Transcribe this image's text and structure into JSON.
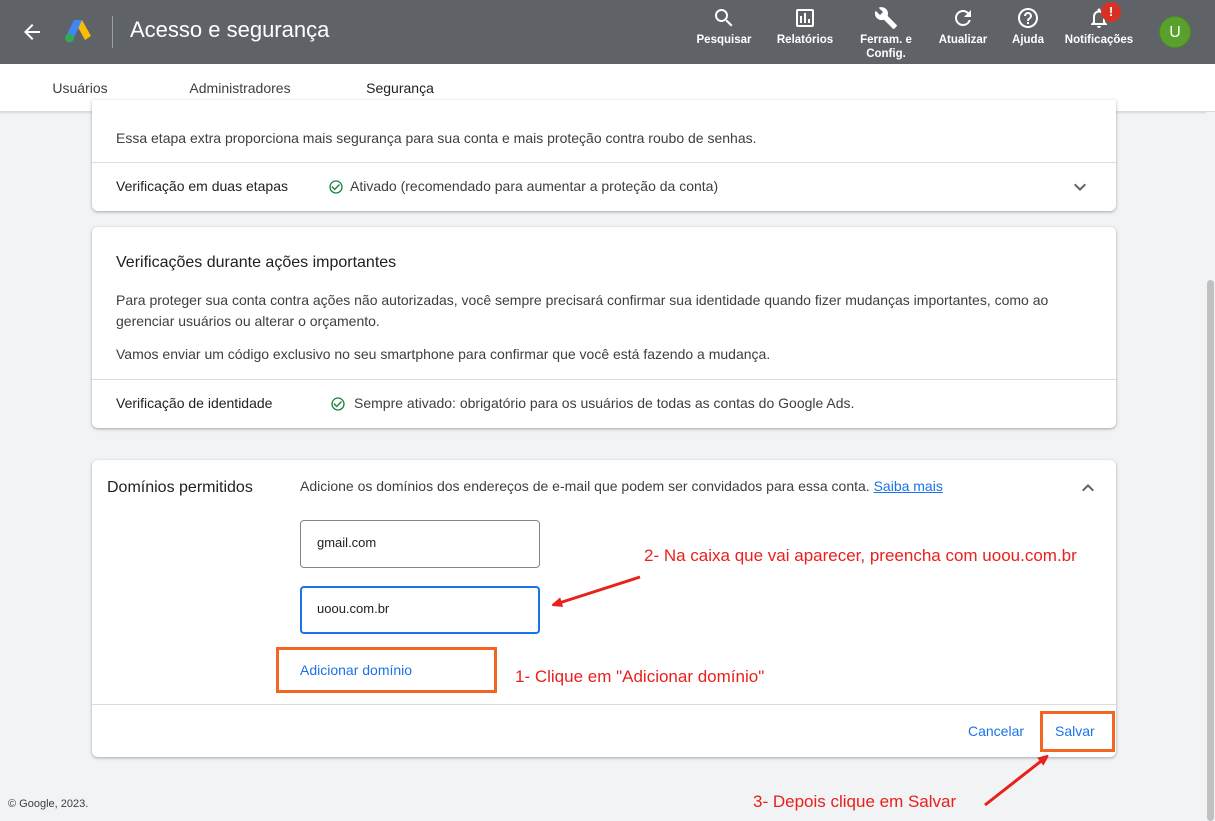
{
  "header": {
    "title": "Acesso e segurança",
    "tools": [
      {
        "label": "Pesquisar",
        "icon": "search-icon"
      },
      {
        "label": "Relatórios",
        "icon": "reports-icon"
      },
      {
        "label": "Ferram. e Config.",
        "icon": "wrench-icon"
      },
      {
        "label": "Atualizar",
        "icon": "refresh-icon"
      },
      {
        "label": "Ajuda",
        "icon": "help-icon"
      },
      {
        "label": "Notificações",
        "icon": "bell-icon"
      }
    ],
    "notification_badge": "!",
    "avatar_letter": "U"
  },
  "tabs": [
    "Usuários",
    "Administradores",
    "Segurança"
  ],
  "active_tab": "Segurança",
  "two_step": {
    "description": "Essa etapa extra proporciona mais segurança para sua conta e mais proteção contra roubo de senhas.",
    "label": "Verificação em duas etapas",
    "status": "Ativado (recomendado para aumentar a proteção da conta)"
  },
  "important_actions": {
    "title": "Verificações durante ações importantes",
    "paragraph1": "Para proteger sua conta contra ações não autorizadas, você sempre precisará confirmar sua identidade quando fizer mudanças importantes, como ao gerenciar usuários ou alterar o orçamento.",
    "paragraph2": "Vamos enviar um código exclusivo no seu smartphone para confirmar que você está fazendo a mudança.",
    "identity_label": "Verificação de identidade",
    "identity_status": "Sempre ativado: obrigatório para os usuários de todas as contas do Google Ads."
  },
  "domains": {
    "title": "Domínios permitidos",
    "description": "Adicione os domínios dos endereços de e-mail que podem ser convidados para essa conta.",
    "learn_more": "Saiba mais",
    "field1_value": "gmail.com",
    "field2_value": "uoou.com.br",
    "add_domain": "Adicionar domínio",
    "cancel": "Cancelar",
    "save": "Salvar"
  },
  "annotations": {
    "step1": "1- Clique em \"Adicionar domínio\"",
    "step2": "2- Na caixa que vai aparecer, preencha com uoou.com.br",
    "step3": "3- Depois clique em Salvar"
  },
  "footer": "© Google, 2023.",
  "colors": {
    "accent": "#1a73e8",
    "header": "#5f6368",
    "annotation": "#e8211c",
    "highlight": "#f26522",
    "success": "#188038"
  }
}
